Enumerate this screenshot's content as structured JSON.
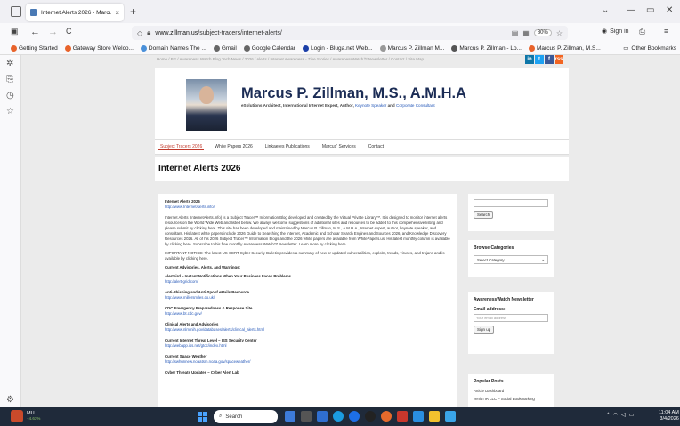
{
  "tab": {
    "title": "Internet Alerts 2026 - Marcus P. Zil",
    "close_glyph": "×",
    "new_glyph": "+"
  },
  "window": {
    "chevron": "⌄",
    "minimize": "—",
    "restore": "▭",
    "close": "✕"
  },
  "nav": {
    "back": "←",
    "forward": "→",
    "reload": "C"
  },
  "url": {
    "host": "www.zillman.us",
    "path": "/subject-tracers/internet-alerts/",
    "zoom": "80%"
  },
  "account": {
    "signin": "Sign in"
  },
  "bookmarks": [
    {
      "label": "Getting Started",
      "color": "#e8632b"
    },
    {
      "label": "Gateway Store Welco...",
      "color": "#e8632b"
    },
    {
      "label": "Domain Names The ...",
      "color": "#4a90d9"
    },
    {
      "label": "Gmail",
      "color": "#666"
    },
    {
      "label": "Google Calendar",
      "color": "#666"
    },
    {
      "label": "Login - Bluga.net Web...",
      "color": "#1b3fa8"
    },
    {
      "label": "Marcus P. Zillman M...",
      "color": "#999"
    },
    {
      "label": "Marcus P. Zillman - Lo...",
      "color": "#555"
    },
    {
      "label": "Marcus P. Zillman, M.S...",
      "color": "#e8632b"
    }
  ],
  "bookmarks_other": "Other Bookmarks",
  "breadcrumbs": "Home / Biz / Awareness Watch Blog Tech News / 2026 / Alerts / Internet Awareness - Zine Stories / AwarenessWatch™ Newsletter / Contact / Site Map",
  "social": [
    {
      "label": "in",
      "color": "#0e76a8"
    },
    {
      "label": "t",
      "color": "#1da1f2"
    },
    {
      "label": "f",
      "color": "#3b5998"
    },
    {
      "label": "rss",
      "color": "#f26522"
    }
  ],
  "header": {
    "title": "Marcus P. Zillman, M.S., A.M.H.A",
    "tagline_parts": [
      "eSolutions Architect, International Internet Expert, Author, ",
      "Keynote Speaker",
      " and ",
      "Corporate Consultant"
    ]
  },
  "menu": [
    {
      "label": "Subject Tracers 2026",
      "active": true
    },
    {
      "label": "White Papers 2026",
      "active": false
    },
    {
      "label": "Linkaeres Publications",
      "active": false
    },
    {
      "label": "Marcus' Services",
      "active": false
    },
    {
      "label": "Contact",
      "active": false
    }
  ],
  "page_title": "Internet Alerts 2026",
  "main": {
    "intro_title": "Internet Alerts 2026",
    "intro_link": "http://www.InternetAlerts.info/",
    "intro_text": "Internet Alerts (InternetAlerts.info) is a Subject Tracer™ Information Blog developed and created by the Virtual Private Library™. It is designed to monitor internet alerts resources on the World Wide Web and listed below. We always welcome suggestions of additional sites and resources to be added to this comprehensive listing and please submit by clicking here. This site has been developed and maintained by Marcus P. Zillman, M.S., A.M.H.A., Internet expert, author, keynote speaker, and consultant. His latest white papers include 2026 Guide to Searching the Internet, Academic and Scholar Search Engines and Sources 2026, and Knowledge Discovery Resources 2026. All of his 2026 Subject Tracer™ Information Blogs and the 2026 white papers are available from WhitePapers.us. His latest monthly column is available by clicking here. Subscribe to his free monthly Awareness Watch™ Newsletter. Learn more by clicking here.",
    "notice": "IMPORTANT NOTICE: The latest US-CERT Cyber Security Bulletin provides a summary of new or updated vulnerabilities, exploits, trends, viruses, and trojans and is available by clicking here.",
    "current_heading": "Current Advisories, Alerts, and Warnings:",
    "entries": [
      {
        "title": "Alertbird – Instant Notifications When Your Business Faces Problems",
        "link": "http://alert-grid.com/"
      },
      {
        "title": "Anti-Phishing and Anti-Spoof eMails Resource",
        "link": "http://www.millersmiles.co.uk/"
      },
      {
        "title": "CDC Emergency Preparedness & Response Site",
        "link": "http://www.bt.cdc.gov/"
      },
      {
        "title": "Clinical Alerts and Advisories",
        "link": "http://www.nlm.nih.gov/databases/alerts/clinical_alerts.html"
      },
      {
        "title": "Current Internet Threat Level – ISS Security Center",
        "link": "http://webapp.iss.net/gtoc/index.html"
      },
      {
        "title": "Current Space Weather",
        "link": "http://swhunnew.noaatsm.noaa.gov/spaceweather/"
      },
      {
        "title": "Cyber Threats Updates – Cyber Alert Lab",
        "link": ""
      }
    ]
  },
  "sidebar_widgets": {
    "search_button": "Search",
    "categories_title": "Browse Categories",
    "categories_select": "Select Category",
    "newsletter_title": "AwarenessWatch Newsletter",
    "email_label": "Email address:",
    "email_placeholder": "Your email address",
    "signup_button": "Sign up",
    "popular_title": "Popular Posts",
    "popular_items": [
      "Article Dashboard",
      "zenith IR LLC – Social Bookmarking"
    ]
  },
  "taskbar": {
    "weather_label": "MU",
    "weather_sub": "+4.63%",
    "search_placeholder": "Search",
    "clock_time": "11:04 AM",
    "clock_date": "3/4/2026"
  }
}
